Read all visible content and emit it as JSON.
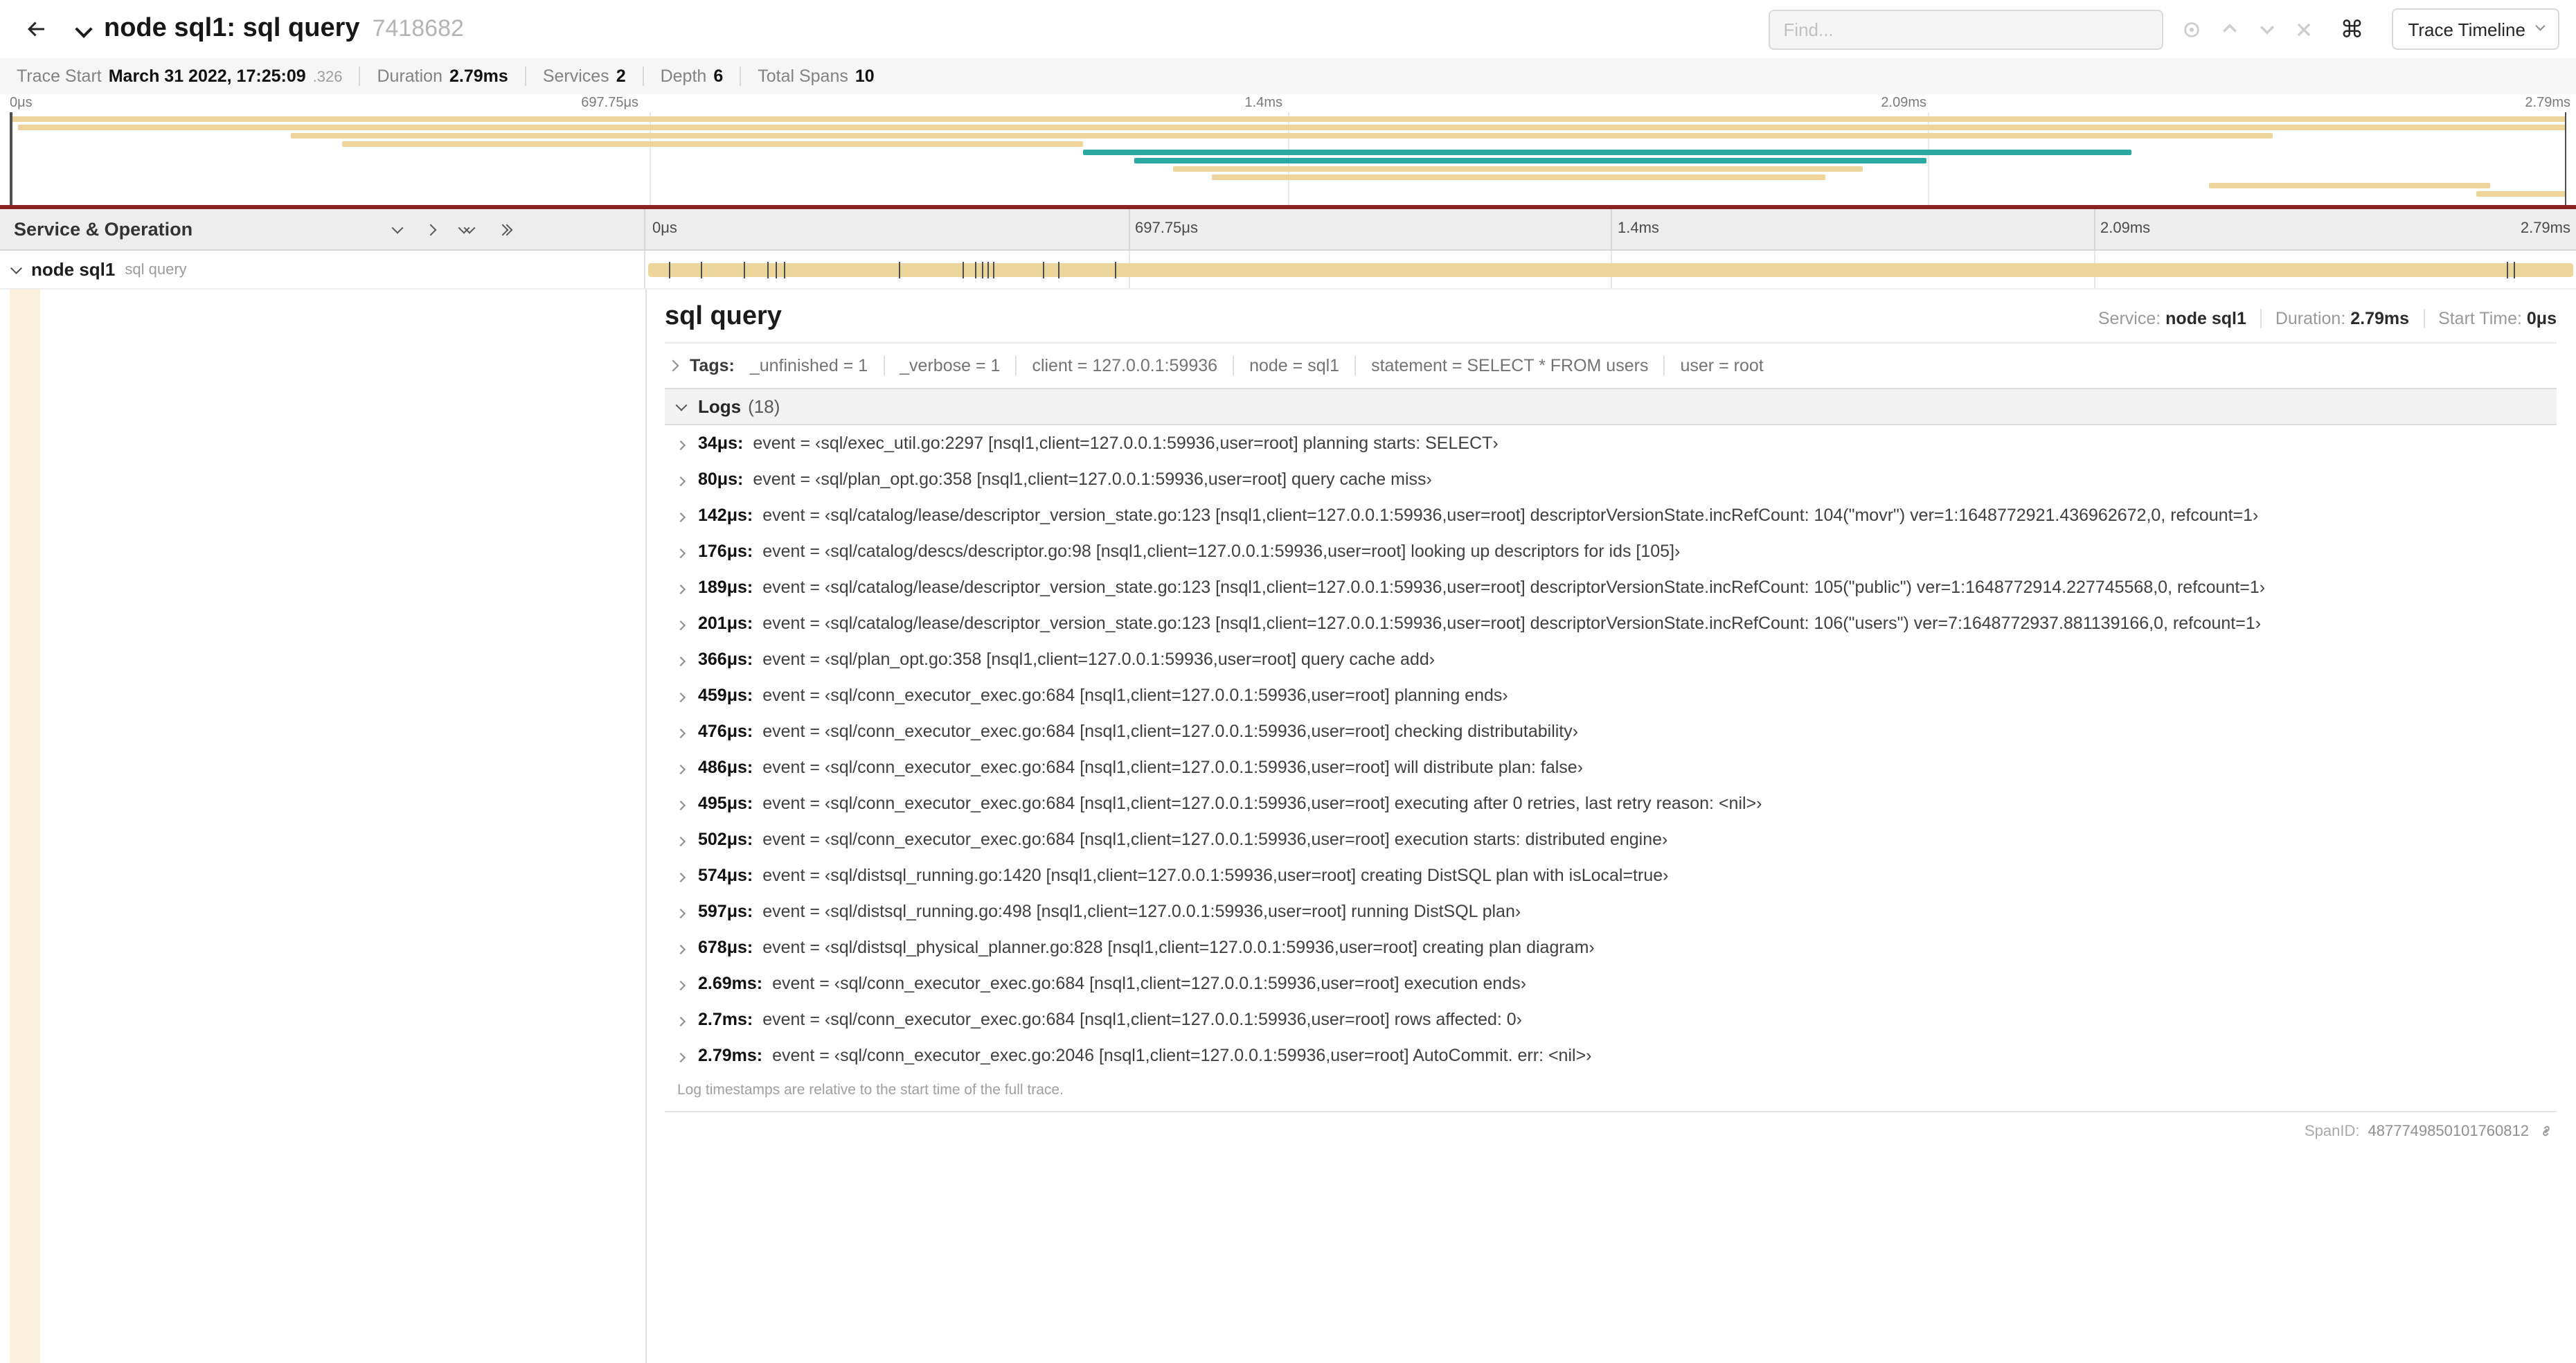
{
  "header": {
    "title": "node sql1: sql query",
    "trace_id": "7418682",
    "find_placeholder": "Find...",
    "shortcut_button": "⌘",
    "view_dropdown": "Trace Timeline"
  },
  "summary": {
    "items": [
      {
        "label": "Trace Start",
        "value": "March 31 2022, 17:25:09",
        "suffix": ".326"
      },
      {
        "label": "Duration",
        "value": "2.79ms"
      },
      {
        "label": "Services",
        "value": "2"
      },
      {
        "label": "Depth",
        "value": "6"
      },
      {
        "label": "Total Spans",
        "value": "10"
      }
    ]
  },
  "timeline": {
    "left_header": "Service & Operation",
    "ticks": [
      "0μs",
      "697.75μs",
      "1.4ms",
      "2.09ms",
      "2.79ms"
    ],
    "tick_positions": [
      0,
      25,
      50,
      75,
      100
    ],
    "total_us": 2790,
    "colors": {
      "tan": "#ECD49B",
      "teal": "#2BA8A0",
      "accent_red": "#8A2424",
      "row_bar": "#EDD69E",
      "detail_accent": "#FBF2DE"
    },
    "collapser": [
      {
        "name": "chevron-down-icon",
        "dir": "down",
        "count": 1
      },
      {
        "name": "chevron-right-icon",
        "dir": "right",
        "count": 1
      },
      {
        "name": "double-chevron-down-icon",
        "dir": "down",
        "count": 2
      },
      {
        "name": "double-chevron-right-icon",
        "dir": "right",
        "count": 2
      }
    ],
    "row": {
      "service": "node sql1",
      "operation": "sql query"
    },
    "minimap_spans": [
      {
        "start": 0,
        "end": 100,
        "color": "tan"
      },
      {
        "start": 0.3,
        "end": 100,
        "color": "tan"
      },
      {
        "start": 11,
        "end": 88.5,
        "color": "tan"
      },
      {
        "start": 13,
        "end": 42,
        "color": "tan"
      },
      {
        "start": 42,
        "end": 83,
        "color": "teal"
      },
      {
        "start": 44,
        "end": 75,
        "color": "teal"
      },
      {
        "start": 45.5,
        "end": 72.5,
        "color": "tan"
      },
      {
        "start": 47,
        "end": 71,
        "color": "tan"
      },
      {
        "start": 86,
        "end": 97,
        "color": "tan"
      },
      {
        "start": 96.5,
        "end": 100,
        "color": "tan"
      }
    ]
  },
  "detail": {
    "title": "sql query",
    "meta": [
      {
        "label": "Service:",
        "value": "node sql1"
      },
      {
        "label": "Duration:",
        "value": "2.79ms"
      },
      {
        "label": "Start Time:",
        "value": "0μs"
      }
    ],
    "tags_label": "Tags:",
    "tags": [
      {
        "key": "_unfinished",
        "value": "1"
      },
      {
        "key": "_verbose",
        "value": "1"
      },
      {
        "key": "client",
        "value": "127.0.0.1:59936"
      },
      {
        "key": "node",
        "value": "sql1"
      },
      {
        "key": "statement",
        "value": "SELECT * FROM users"
      },
      {
        "key": "user",
        "value": "root"
      }
    ],
    "logs_label": "Logs",
    "logs_count": "(18)",
    "logs": [
      {
        "time": "34μs",
        "time_us": 34,
        "field": "event",
        "message": "‹sql/exec_util.go:2297 [nsql1,client=127.0.0.1:59936,user=root] planning starts: SELECT›"
      },
      {
        "time": "80μs",
        "time_us": 80,
        "field": "event",
        "message": "‹sql/plan_opt.go:358 [nsql1,client=127.0.0.1:59936,user=root] query cache miss›"
      },
      {
        "time": "142μs",
        "time_us": 142,
        "field": "event",
        "message": "‹sql/catalog/lease/descriptor_version_state.go:123 [nsql1,client=127.0.0.1:59936,user=root] descriptorVersionState.incRefCount: 104(\"movr\") ver=1:1648772921.436962672,0, refcount=1›"
      },
      {
        "time": "176μs",
        "time_us": 176,
        "field": "event",
        "message": "‹sql/catalog/descs/descriptor.go:98 [nsql1,client=127.0.0.1:59936,user=root] looking up descriptors for ids [105]›"
      },
      {
        "time": "189μs",
        "time_us": 189,
        "field": "event",
        "message": "‹sql/catalog/lease/descriptor_version_state.go:123 [nsql1,client=127.0.0.1:59936,user=root] descriptorVersionState.incRefCount: 105(\"public\") ver=1:1648772914.227745568,0, refcount=1›"
      },
      {
        "time": "201μs",
        "time_us": 201,
        "field": "event",
        "message": "‹sql/catalog/lease/descriptor_version_state.go:123 [nsql1,client=127.0.0.1:59936,user=root] descriptorVersionState.incRefCount: 106(\"users\") ver=7:1648772937.881139166,0, refcount=1›"
      },
      {
        "time": "366μs",
        "time_us": 366,
        "field": "event",
        "message": "‹sql/plan_opt.go:358 [nsql1,client=127.0.0.1:59936,user=root] query cache add›"
      },
      {
        "time": "459μs",
        "time_us": 459,
        "field": "event",
        "message": "‹sql/conn_executor_exec.go:684 [nsql1,client=127.0.0.1:59936,user=root] planning ends›"
      },
      {
        "time": "476μs",
        "time_us": 476,
        "field": "event",
        "message": "‹sql/conn_executor_exec.go:684 [nsql1,client=127.0.0.1:59936,user=root] checking distributability›"
      },
      {
        "time": "486μs",
        "time_us": 486,
        "field": "event",
        "message": "‹sql/conn_executor_exec.go:684 [nsql1,client=127.0.0.1:59936,user=root] will distribute plan: false›"
      },
      {
        "time": "495μs",
        "time_us": 495,
        "field": "event",
        "message": "‹sql/conn_executor_exec.go:684 [nsql1,client=127.0.0.1:59936,user=root] executing after 0 retries, last retry reason: <nil>›"
      },
      {
        "time": "502μs",
        "time_us": 502,
        "field": "event",
        "message": "‹sql/conn_executor_exec.go:684 [nsql1,client=127.0.0.1:59936,user=root] execution starts: distributed engine›"
      },
      {
        "time": "574μs",
        "time_us": 574,
        "field": "event",
        "message": "‹sql/distsql_running.go:1420 [nsql1,client=127.0.0.1:59936,user=root] creating DistSQL plan with isLocal=true›"
      },
      {
        "time": "597μs",
        "time_us": 597,
        "field": "event",
        "message": "‹sql/distsql_running.go:498 [nsql1,client=127.0.0.1:59936,user=root] running DistSQL plan›"
      },
      {
        "time": "678μs",
        "time_us": 678,
        "field": "event",
        "message": "‹sql/distsql_physical_planner.go:828 [nsql1,client=127.0.0.1:59936,user=root] creating plan diagram›"
      },
      {
        "time": "2.69ms",
        "time_us": 2690,
        "field": "event",
        "message": "‹sql/conn_executor_exec.go:684 [nsql1,client=127.0.0.1:59936,user=root] execution ends›"
      },
      {
        "time": "2.7ms",
        "time_us": 2700,
        "field": "event",
        "message": "‹sql/conn_executor_exec.go:684 [nsql1,client=127.0.0.1:59936,user=root] rows affected: 0›"
      },
      {
        "time": "2.79ms",
        "time_us": 2790,
        "field": "event",
        "message": "‹sql/conn_executor_exec.go:2046 [nsql1,client=127.0.0.1:59936,user=root] AutoCommit. err: <nil>›"
      }
    ],
    "logs_note": "Log timestamps are relative to the start time of the full trace.",
    "span_id_label": "SpanID:",
    "span_id": "4877749850101760812"
  }
}
